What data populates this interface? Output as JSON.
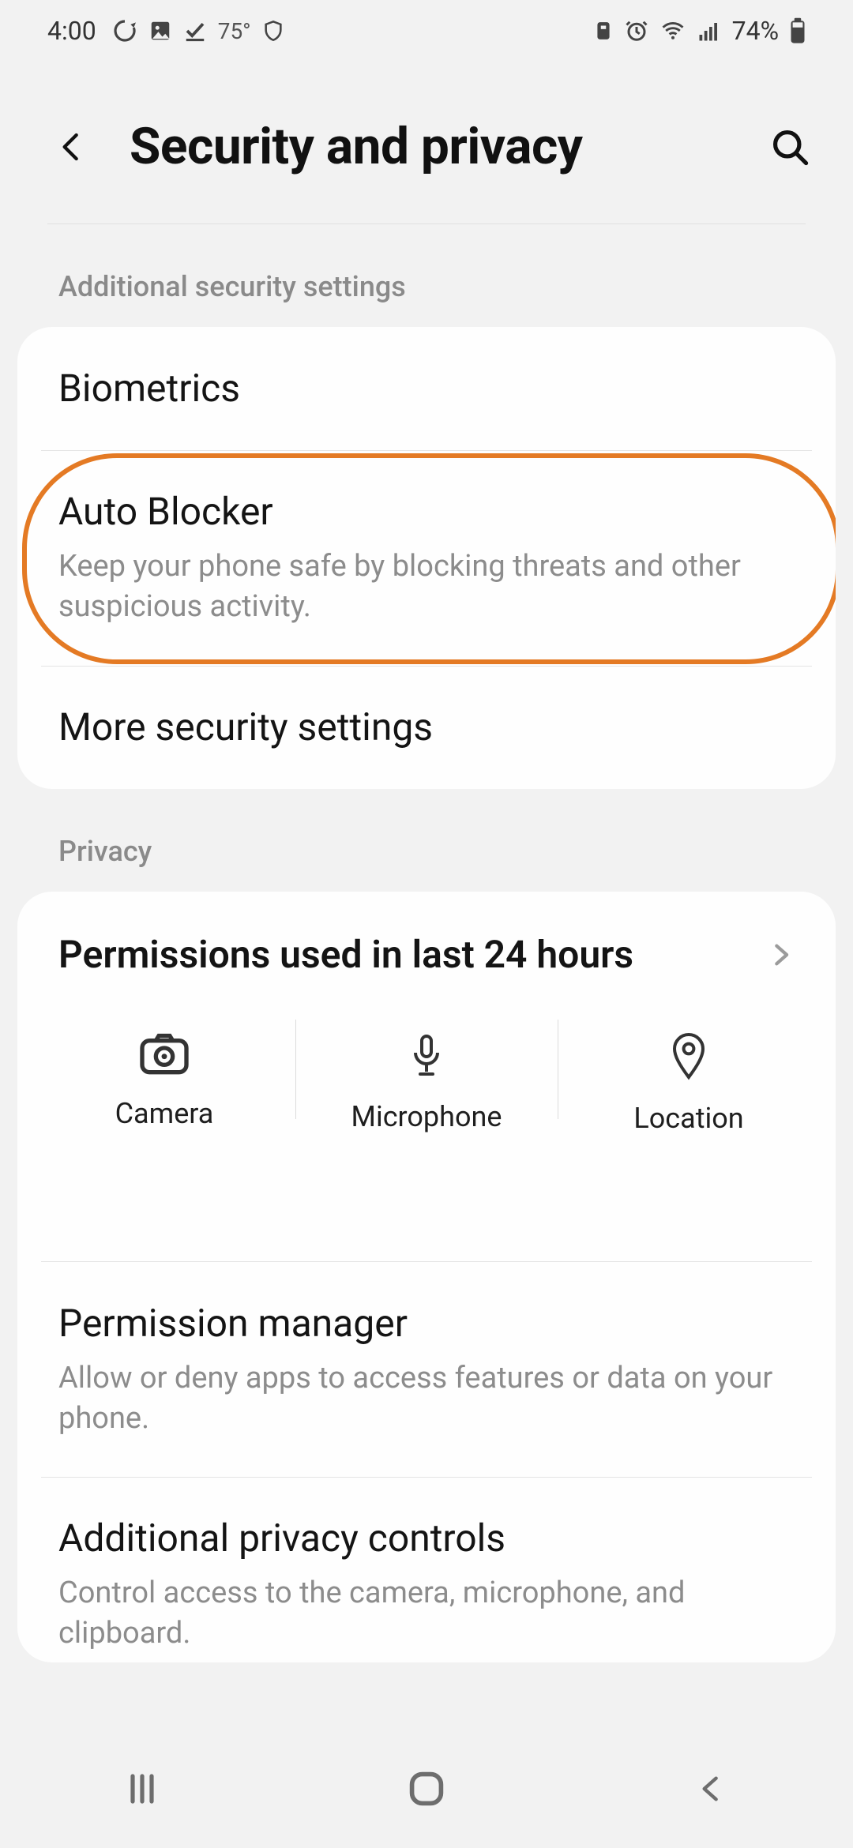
{
  "status": {
    "time": "4:00",
    "temp": "75°",
    "battery_pct": "74%"
  },
  "header": {
    "title": "Security and privacy"
  },
  "section1": {
    "label": "Additional security settings",
    "biometrics": "Biometrics",
    "auto_blocker_title": "Auto Blocker",
    "auto_blocker_sub": "Keep your phone safe by blocking threats and other suspicious activity.",
    "more_security": "More security settings"
  },
  "section2": {
    "label": "Privacy",
    "perm_used": "Permissions used in last 24 hours",
    "camera": "Camera",
    "microphone": "Microphone",
    "location": "Location",
    "perm_mgr_title": "Permission manager",
    "perm_mgr_sub": "Allow or deny apps to access features or data on your phone.",
    "addl_priv_title": "Additional privacy controls",
    "addl_priv_sub": "Control access to the camera, microphone, and clipboard."
  }
}
